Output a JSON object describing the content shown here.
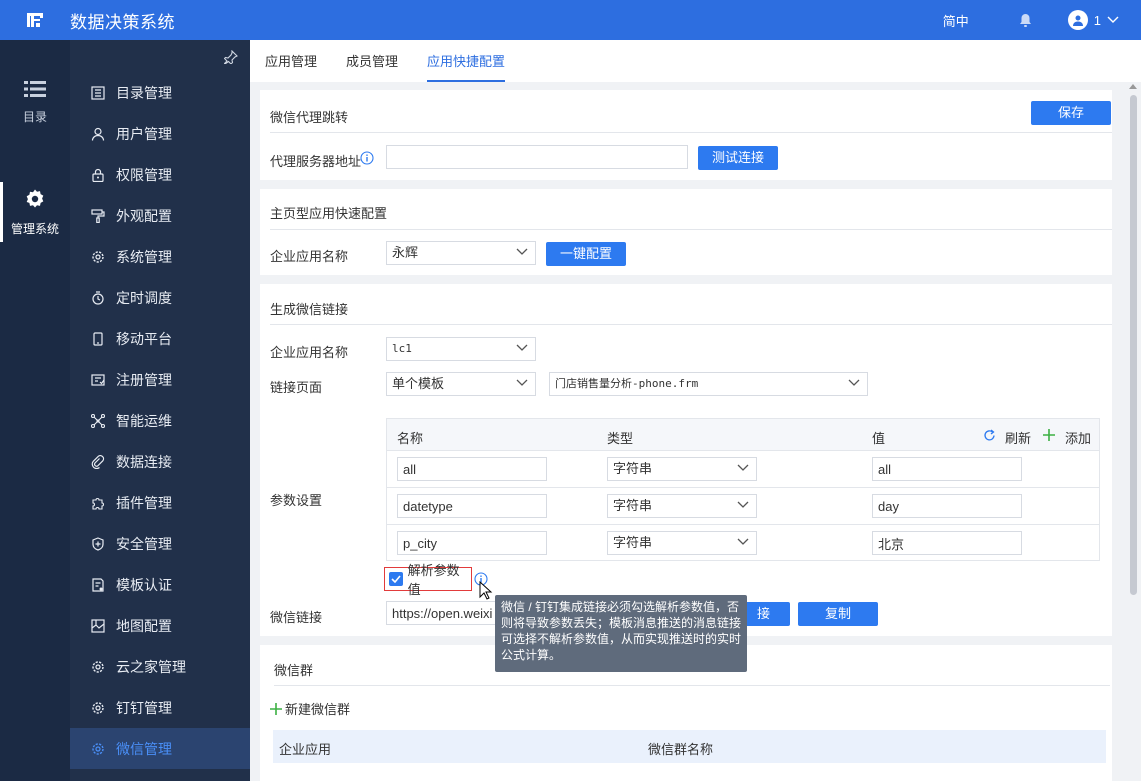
{
  "app": {
    "title": "数据决策系统",
    "lang": "简中",
    "user": "1"
  },
  "rail": [
    {
      "label": "目录",
      "icon": "list-icon"
    },
    {
      "label": "管理系统",
      "icon": "gear-icon",
      "active": true
    }
  ],
  "sidebar": {
    "items": [
      {
        "label": "目录管理",
        "icon": "catalog-icon"
      },
      {
        "label": "用户管理",
        "icon": "user-icon"
      },
      {
        "label": "权限管理",
        "icon": "lock-icon"
      },
      {
        "label": "外观配置",
        "icon": "paint-roller-icon"
      },
      {
        "label": "系统管理",
        "icon": "gear-icon"
      },
      {
        "label": "定时调度",
        "icon": "timer-icon"
      },
      {
        "label": "移动平台",
        "icon": "mobile-icon"
      },
      {
        "label": "注册管理",
        "icon": "register-icon"
      },
      {
        "label": "智能运维",
        "icon": "network-icon"
      },
      {
        "label": "数据连接",
        "icon": "link-icon"
      },
      {
        "label": "插件管理",
        "icon": "puzzle-icon"
      },
      {
        "label": "安全管理",
        "icon": "shield-icon"
      },
      {
        "label": "模板认证",
        "icon": "template-icon"
      },
      {
        "label": "地图配置",
        "icon": "map-icon"
      },
      {
        "label": "云之家管理",
        "icon": "gear-icon"
      },
      {
        "label": "钉钉管理",
        "icon": "gear-icon"
      },
      {
        "label": "微信管理",
        "icon": "gear-icon",
        "active": true
      }
    ]
  },
  "tabs": [
    {
      "label": "应用管理"
    },
    {
      "label": "成员管理"
    },
    {
      "label": "应用快捷配置",
      "active": true
    }
  ],
  "proxy": {
    "title": "微信代理跳转",
    "save": "保存",
    "server_label": "代理服务器地址",
    "server_value": "",
    "test": "测试连接"
  },
  "homepage": {
    "title": "主页型应用快速配置",
    "app_label": "企业应用名称",
    "app_value": "永辉",
    "config": "一键配置"
  },
  "link": {
    "title": "生成微信链接",
    "app_label": "企业应用名称",
    "app_value": "lc1",
    "page_label": "链接页面",
    "page_type": "单个模板",
    "page_file": "门店销售量分析-phone.frm",
    "params_label": "参数设置",
    "params": {
      "col_name": "名称",
      "col_type": "类型",
      "col_value": "值",
      "refresh": "刷新",
      "add": "添加",
      "rows": [
        {
          "name": "all",
          "type": "字符串",
          "value": "all"
        },
        {
          "name": "datetype",
          "type": "字符串",
          "value": "day"
        },
        {
          "name": "p_city",
          "type": "字符串",
          "value": "北京"
        }
      ]
    },
    "parse_label": "解析参数值",
    "tooltip": "微信 / 钉钉集成链接必须勾选解析参数值，否则将导致参数丢失；模板消息推送的消息链接可选择不解析参数值，从而实现推送时的实时公式计算。",
    "wx_link_label": "微信链接",
    "wx_link_value": "https://open.weixi",
    "connect_tail": "接",
    "copy": "复制"
  },
  "group": {
    "title": "微信群",
    "add": "新建微信群",
    "col_app": "企业应用",
    "col_group": "微信群名称"
  },
  "colors": {
    "primary": "#2d6ee0",
    "sidebar": "#21304a",
    "rail": "#1b2a44",
    "active_text": "#4a8ff7"
  }
}
